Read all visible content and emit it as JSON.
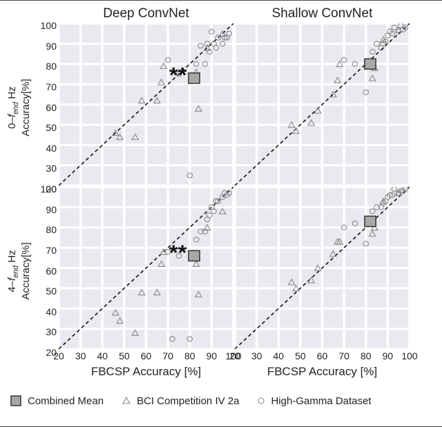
{
  "titles": {
    "col1": "Deep ConvNet",
    "col2": "Shallow ConvNet"
  },
  "row_labels": {
    "row1_prefix": "0–",
    "row2_prefix": "4–",
    "f": "f",
    "end": "end",
    "hz": " Hz",
    "metric": "Accuracy[%]"
  },
  "xlabel": "FBCSP Accuracy [%]",
  "legend": {
    "combined": "Combined Mean",
    "bci": "BCI Competition IV 2a",
    "hg": "High-Gamma Dataset"
  },
  "axis": {
    "ticks": [
      20,
      30,
      40,
      50,
      60,
      70,
      80,
      90,
      100
    ],
    "range": [
      20,
      100
    ]
  },
  "chart_data": [
    {
      "id": "deep_0fend",
      "type": "scatter",
      "row": 0,
      "col": 0,
      "xlabel": "FBCSP Accuracy [%]",
      "ylabel": "0–f_end Hz Accuracy[%]",
      "xlim": [
        20,
        100
      ],
      "ylim": [
        20,
        100
      ],
      "significance": "**",
      "combined_mean": {
        "x": 82,
        "y": 73
      },
      "series": [
        {
          "name": "BCI Competition IV 2a",
          "marker": "triangle",
          "points": [
            {
              "x": 46,
              "y": 46
            },
            {
              "x": 48,
              "y": 44
            },
            {
              "x": 55,
              "y": 44
            },
            {
              "x": 58,
              "y": 62
            },
            {
              "x": 65,
              "y": 62
            },
            {
              "x": 67,
              "y": 71
            },
            {
              "x": 68,
              "y": 79
            },
            {
              "x": 83,
              "y": 76
            },
            {
              "x": 84,
              "y": 58
            },
            {
              "x": 88,
              "y": 88
            },
            {
              "x": 95,
              "y": 95
            }
          ]
        },
        {
          "name": "High-Gamma Dataset",
          "marker": "circle",
          "points": [
            {
              "x": 70,
              "y": 82
            },
            {
              "x": 75,
              "y": 75
            },
            {
              "x": 80,
              "y": 25
            },
            {
              "x": 83,
              "y": 80
            },
            {
              "x": 85,
              "y": 89
            },
            {
              "x": 87,
              "y": 80
            },
            {
              "x": 88,
              "y": 90
            },
            {
              "x": 89,
              "y": 86
            },
            {
              "x": 90,
              "y": 96
            },
            {
              "x": 91,
              "y": 90
            },
            {
              "x": 92,
              "y": 88
            },
            {
              "x": 93,
              "y": 93
            },
            {
              "x": 95,
              "y": 90
            },
            {
              "x": 96,
              "y": 93
            },
            {
              "x": 97,
              "y": 93
            },
            {
              "x": 98,
              "y": 95
            }
          ]
        }
      ]
    },
    {
      "id": "shallow_0fend",
      "type": "scatter",
      "row": 0,
      "col": 1,
      "xlabel": "FBCSP Accuracy [%]",
      "ylabel": "0–f_end Hz Accuracy[%]",
      "xlim": [
        20,
        100
      ],
      "ylim": [
        20,
        100
      ],
      "combined_mean": {
        "x": 82,
        "y": 80
      },
      "series": [
        {
          "name": "BCI Competition IV 2a",
          "marker": "triangle",
          "points": [
            {
              "x": 46,
              "y": 50
            },
            {
              "x": 48,
              "y": 47
            },
            {
              "x": 55,
              "y": 51
            },
            {
              "x": 58,
              "y": 57
            },
            {
              "x": 65,
              "y": 65
            },
            {
              "x": 67,
              "y": 72
            },
            {
              "x": 68,
              "y": 80
            },
            {
              "x": 83,
              "y": 73
            },
            {
              "x": 84,
              "y": 78
            },
            {
              "x": 88,
              "y": 92
            },
            {
              "x": 95,
              "y": 97
            }
          ]
        },
        {
          "name": "High-Gamma Dataset",
          "marker": "circle",
          "points": [
            {
              "x": 70,
              "y": 82
            },
            {
              "x": 75,
              "y": 80
            },
            {
              "x": 80,
              "y": 66
            },
            {
              "x": 83,
              "y": 86
            },
            {
              "x": 85,
              "y": 90
            },
            {
              "x": 87,
              "y": 88
            },
            {
              "x": 88,
              "y": 90
            },
            {
              "x": 89,
              "y": 91
            },
            {
              "x": 90,
              "y": 94
            },
            {
              "x": 91,
              "y": 96
            },
            {
              "x": 92,
              "y": 95
            },
            {
              "x": 93,
              "y": 98
            },
            {
              "x": 95,
              "y": 96
            },
            {
              "x": 96,
              "y": 99
            },
            {
              "x": 97,
              "y": 97
            },
            {
              "x": 98,
              "y": 98
            }
          ]
        }
      ]
    },
    {
      "id": "deep_4fend",
      "type": "scatter",
      "row": 1,
      "col": 0,
      "xlabel": "FBCSP Accuracy [%]",
      "ylabel": "4–f_end Hz Accuracy[%]",
      "xlim": [
        20,
        100
      ],
      "ylim": [
        20,
        100
      ],
      "significance": "**",
      "combined_mean": {
        "x": 82,
        "y": 66
      },
      "series": [
        {
          "name": "BCI Competition IV 2a",
          "marker": "triangle",
          "points": [
            {
              "x": 46,
              "y": 38
            },
            {
              "x": 48,
              "y": 34
            },
            {
              "x": 55,
              "y": 28
            },
            {
              "x": 58,
              "y": 48
            },
            {
              "x": 65,
              "y": 48
            },
            {
              "x": 67,
              "y": 62
            },
            {
              "x": 68,
              "y": 68
            },
            {
              "x": 83,
              "y": 62
            },
            {
              "x": 84,
              "y": 47
            },
            {
              "x": 88,
              "y": 80
            },
            {
              "x": 95,
              "y": 88
            }
          ]
        },
        {
          "name": "High-Gamma Dataset",
          "marker": "circle",
          "points": [
            {
              "x": 70,
              "y": 68
            },
            {
              "x": 72,
              "y": 25
            },
            {
              "x": 75,
              "y": 66
            },
            {
              "x": 80,
              "y": 25
            },
            {
              "x": 83,
              "y": 74
            },
            {
              "x": 85,
              "y": 78
            },
            {
              "x": 87,
              "y": 78
            },
            {
              "x": 88,
              "y": 84
            },
            {
              "x": 89,
              "y": 86
            },
            {
              "x": 90,
              "y": 90
            },
            {
              "x": 91,
              "y": 88
            },
            {
              "x": 92,
              "y": 93
            },
            {
              "x": 93,
              "y": 93
            },
            {
              "x": 95,
              "y": 95
            },
            {
              "x": 96,
              "y": 97
            },
            {
              "x": 97,
              "y": 96
            },
            {
              "x": 98,
              "y": 97
            }
          ]
        }
      ]
    },
    {
      "id": "shallow_4fend",
      "type": "scatter",
      "row": 1,
      "col": 1,
      "xlabel": "FBCSP Accuracy [%]",
      "ylabel": "4–f_end Hz Accuracy[%]",
      "xlim": [
        20,
        100
      ],
      "ylim": [
        20,
        100
      ],
      "combined_mean": {
        "x": 82,
        "y": 83
      },
      "series": [
        {
          "name": "BCI Competition IV 2a",
          "marker": "triangle",
          "points": [
            {
              "x": 46,
              "y": 53
            },
            {
              "x": 48,
              "y": 50
            },
            {
              "x": 55,
              "y": 54
            },
            {
              "x": 58,
              "y": 60
            },
            {
              "x": 65,
              "y": 67
            },
            {
              "x": 67,
              "y": 73
            },
            {
              "x": 68,
              "y": 73
            },
            {
              "x": 83,
              "y": 77
            },
            {
              "x": 84,
              "y": 80
            },
            {
              "x": 88,
              "y": 93
            },
            {
              "x": 95,
              "y": 97
            }
          ]
        },
        {
          "name": "High-Gamma Dataset",
          "marker": "circle",
          "points": [
            {
              "x": 70,
              "y": 80
            },
            {
              "x": 75,
              "y": 82
            },
            {
              "x": 80,
              "y": 72
            },
            {
              "x": 83,
              "y": 88
            },
            {
              "x": 85,
              "y": 90
            },
            {
              "x": 87,
              "y": 90
            },
            {
              "x": 88,
              "y": 92
            },
            {
              "x": 89,
              "y": 93
            },
            {
              "x": 90,
              "y": 95
            },
            {
              "x": 91,
              "y": 96
            },
            {
              "x": 92,
              "y": 96
            },
            {
              "x": 93,
              "y": 99
            },
            {
              "x": 95,
              "y": 97
            },
            {
              "x": 96,
              "y": 98
            },
            {
              "x": 97,
              "y": 98
            },
            {
              "x": 98,
              "y": 99
            }
          ]
        }
      ]
    }
  ]
}
